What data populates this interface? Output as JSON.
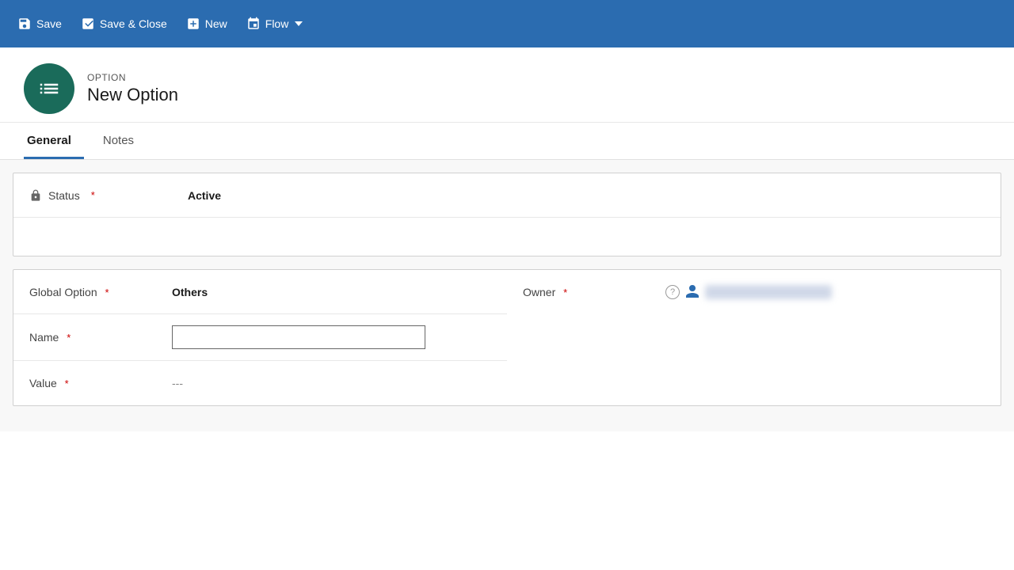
{
  "toolbar": {
    "save_label": "Save",
    "save_close_label": "Save & Close",
    "new_label": "New",
    "flow_label": "Flow"
  },
  "header": {
    "entity_type": "OPTION",
    "entity_name": "New Option"
  },
  "tabs": [
    {
      "id": "general",
      "label": "General",
      "active": true
    },
    {
      "id": "notes",
      "label": "Notes",
      "active": false
    }
  ],
  "form": {
    "status_label": "Status",
    "status_value": "Active",
    "global_option_label": "Global Option",
    "global_option_value": "Others",
    "owner_label": "Owner",
    "owner_value": "",
    "name_label": "Name",
    "name_value": "",
    "name_placeholder": "",
    "value_label": "Value",
    "value_placeholder": "---"
  },
  "required_indicator": "*",
  "icons": {
    "save": "save-icon",
    "save_close": "save-close-icon",
    "new": "new-icon",
    "flow": "flow-icon",
    "entity": "entity-icon",
    "lock": "lock-icon",
    "help": "help-icon",
    "person": "person-icon"
  }
}
